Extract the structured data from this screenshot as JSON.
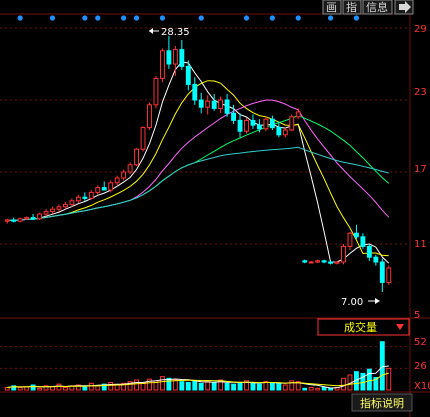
{
  "colors": {
    "background": "#000000",
    "grid": "#6e1010",
    "axis_text": "#ff3333",
    "up_candle": "#ff3333",
    "down_candle": "#00ffff",
    "marker_dot": "#1e90ff",
    "ma_lines": [
      "#ffffff",
      "#ffff00",
      "#ff66ff",
      "#00ff66",
      "#33cccc",
      "#cc66ff"
    ],
    "panel_title": "#ffff00",
    "panel_title_border": "#ff3333"
  },
  "toolbar": {
    "buttons": [
      {
        "label": "画",
        "icon": "draw-icon"
      },
      {
        "label": "指",
        "icon": ""
      },
      {
        "label": "信息",
        "icon": ""
      },
      {
        "label": "",
        "icon": "arrow-right-icon"
      }
    ]
  },
  "volume_panel": {
    "title": "成交量",
    "dropdown_icon": "triangle-down-icon"
  },
  "footer": {
    "indicator_help_label": "指标说明"
  },
  "chart_data": [
    {
      "type": "candlestick",
      "yticks": [
        "29",
        "23",
        "17",
        "11",
        "5"
      ],
      "ylim": [
        5,
        29
      ],
      "grid": true,
      "annotations": [
        {
          "text": "28.35",
          "value": 28.35
        },
        {
          "text": "7.00",
          "value": 7.0
        }
      ],
      "marker_count": 13,
      "candles": [
        [
          12.9,
          13.1,
          12.7,
          13.0
        ],
        [
          13.0,
          13.2,
          12.8,
          12.9
        ],
        [
          12.9,
          13.2,
          12.8,
          13.1
        ],
        [
          13.1,
          13.3,
          13.0,
          13.2
        ],
        [
          13.2,
          13.5,
          13.0,
          13.1
        ],
        [
          13.1,
          13.6,
          13.0,
          13.5
        ],
        [
          13.5,
          13.9,
          13.3,
          13.7
        ],
        [
          13.7,
          14.1,
          13.5,
          13.9
        ],
        [
          13.9,
          14.3,
          13.7,
          14.1
        ],
        [
          14.1,
          14.5,
          13.9,
          14.3
        ],
        [
          14.3,
          14.8,
          14.1,
          14.6
        ],
        [
          14.6,
          15.1,
          14.4,
          14.9
        ],
        [
          14.9,
          15.3,
          14.6,
          14.8
        ],
        [
          14.8,
          15.5,
          14.7,
          15.3
        ],
        [
          15.3,
          15.9,
          15.1,
          15.7
        ],
        [
          15.7,
          16.2,
          15.5,
          15.5
        ],
        [
          15.5,
          16.3,
          15.3,
          16.1
        ],
        [
          16.1,
          16.7,
          15.9,
          16.5
        ],
        [
          16.5,
          17.2,
          16.3,
          17.0
        ],
        [
          17.0,
          17.8,
          16.8,
          17.6
        ],
        [
          17.6,
          19.0,
          17.5,
          18.9
        ],
        [
          18.9,
          20.8,
          18.7,
          20.7
        ],
        [
          20.7,
          22.8,
          20.5,
          22.6
        ],
        [
          22.6,
          25.0,
          22.3,
          24.8
        ],
        [
          24.8,
          27.3,
          24.5,
          27.1
        ],
        [
          27.1,
          28.35,
          25.6,
          26.0
        ],
        [
          26.0,
          27.5,
          25.0,
          27.2
        ],
        [
          27.2,
          28.0,
          25.5,
          25.8
        ],
        [
          25.8,
          26.3,
          23.8,
          24.3
        ],
        [
          24.3,
          24.9,
          22.6,
          23.0
        ],
        [
          23.0,
          23.6,
          21.9,
          22.4
        ],
        [
          22.4,
          23.4,
          21.8,
          22.9
        ],
        [
          22.9,
          23.5,
          22.1,
          22.3
        ],
        [
          22.3,
          23.3,
          21.9,
          23.0
        ],
        [
          23.0,
          23.5,
          21.6,
          21.9
        ],
        [
          21.9,
          22.6,
          21.0,
          21.3
        ],
        [
          21.3,
          21.9,
          19.9,
          20.4
        ],
        [
          20.4,
          21.5,
          20.2,
          21.3
        ],
        [
          21.3,
          21.8,
          20.6,
          20.9
        ],
        [
          20.9,
          21.4,
          20.3,
          20.6
        ],
        [
          20.6,
          21.6,
          20.4,
          21.4
        ],
        [
          21.4,
          21.7,
          20.5,
          20.7
        ],
        [
          20.7,
          21.2,
          19.9,
          20.1
        ],
        [
          20.1,
          20.7,
          19.9,
          20.5
        ],
        [
          20.5,
          21.8,
          20.4,
          21.6
        ],
        [
          21.6,
          22.3,
          21.4,
          22.0
        ],
        [
          9.6,
          9.7,
          9.4,
          9.5
        ],
        [
          9.5,
          9.6,
          9.4,
          9.5
        ],
        [
          9.5,
          9.7,
          9.4,
          9.6
        ],
        [
          9.6,
          9.7,
          9.4,
          9.5
        ],
        [
          9.5,
          9.6,
          9.3,
          9.4
        ],
        [
          9.4,
          9.6,
          9.3,
          9.5
        ],
        [
          9.5,
          11.0,
          9.3,
          10.8
        ],
        [
          10.8,
          12.0,
          10.5,
          11.9
        ],
        [
          11.9,
          12.6,
          11.4,
          11.6
        ],
        [
          11.6,
          11.9,
          10.6,
          10.8
        ],
        [
          10.8,
          11.0,
          9.6,
          9.9
        ],
        [
          9.9,
          10.1,
          9.2,
          9.5
        ],
        [
          9.5,
          9.8,
          7.0,
          7.8
        ],
        [
          7.8,
          9.2,
          7.6,
          9.0
        ]
      ]
    },
    {
      "type": "bar",
      "yticks": [
        "52",
        "26",
        "X10"
      ],
      "ylim": [
        0,
        60
      ],
      "values": [
        3,
        5,
        3,
        4,
        6,
        2,
        5,
        4,
        7,
        3,
        5,
        6,
        4,
        8,
        5,
        7,
        9,
        6,
        8,
        10,
        12,
        9,
        13,
        11,
        16,
        14,
        12,
        10,
        9,
        11,
        8,
        10,
        9,
        12,
        8,
        7,
        9,
        11,
        8,
        7,
        10,
        9,
        8,
        6,
        11,
        10,
        2,
        3,
        2,
        3,
        2,
        3,
        14,
        18,
        22,
        20,
        25,
        15,
        58,
        26
      ]
    }
  ]
}
